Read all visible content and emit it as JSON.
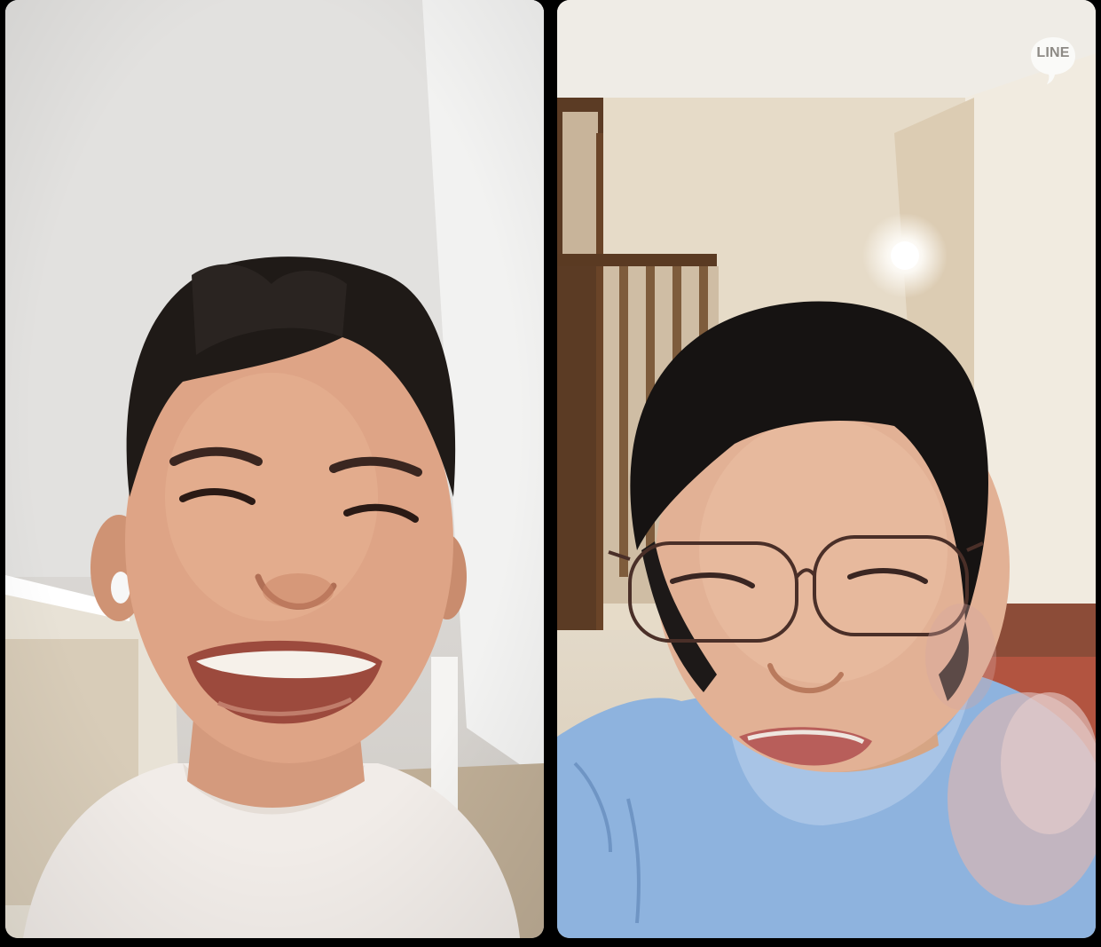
{
  "call": {
    "app_badge": {
      "icon": "line-logo-icon",
      "label": "LINE"
    },
    "participants": [
      {
        "role": "self-video",
        "image": "video-feed-person-smiling-with-earbud"
      },
      {
        "role": "remote-video",
        "image": "video-feed-person-with-glasses-waving"
      }
    ]
  }
}
